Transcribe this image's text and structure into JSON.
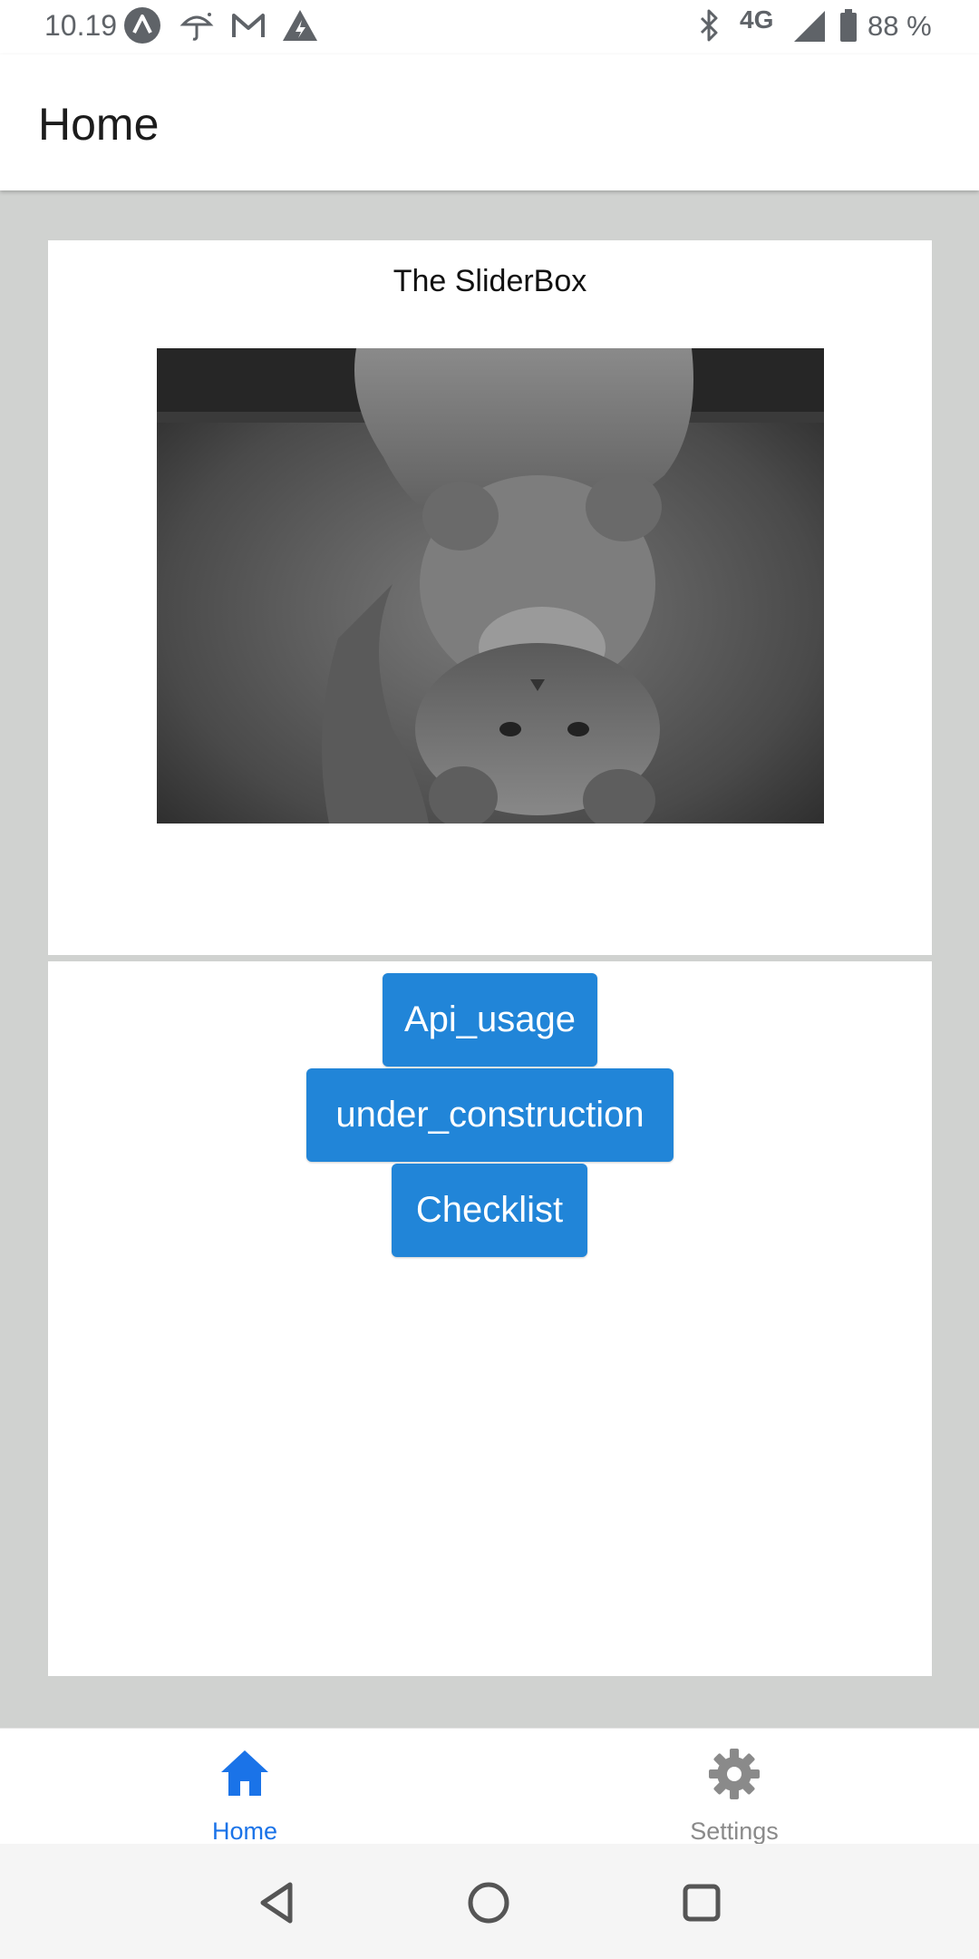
{
  "status_bar": {
    "time": "10.19",
    "network": "4G",
    "battery": "88 %",
    "icons": [
      "arc-app-icon",
      "umbrella-icon",
      "gmail-icon",
      "warning-icon",
      "bluetooth-icon",
      "signal-icon",
      "battery-icon"
    ]
  },
  "app_bar": {
    "title": "Home"
  },
  "slider": {
    "title": "The SliderBox",
    "page_count": 1,
    "current_page": 1
  },
  "buttons": {
    "api_usage": "Api_usage",
    "under_construction": "under_construction",
    "checklist": "Checklist"
  },
  "tabs": [
    {
      "label": "Home",
      "icon": "home-icon",
      "active": true
    },
    {
      "label": "Settings",
      "icon": "gear-icon",
      "active": false
    }
  ],
  "colors": {
    "accent": "#2185d8",
    "tab_active": "#1a73e8",
    "tab_inactive": "#8a8a8a",
    "background": "#d0d2d0"
  }
}
